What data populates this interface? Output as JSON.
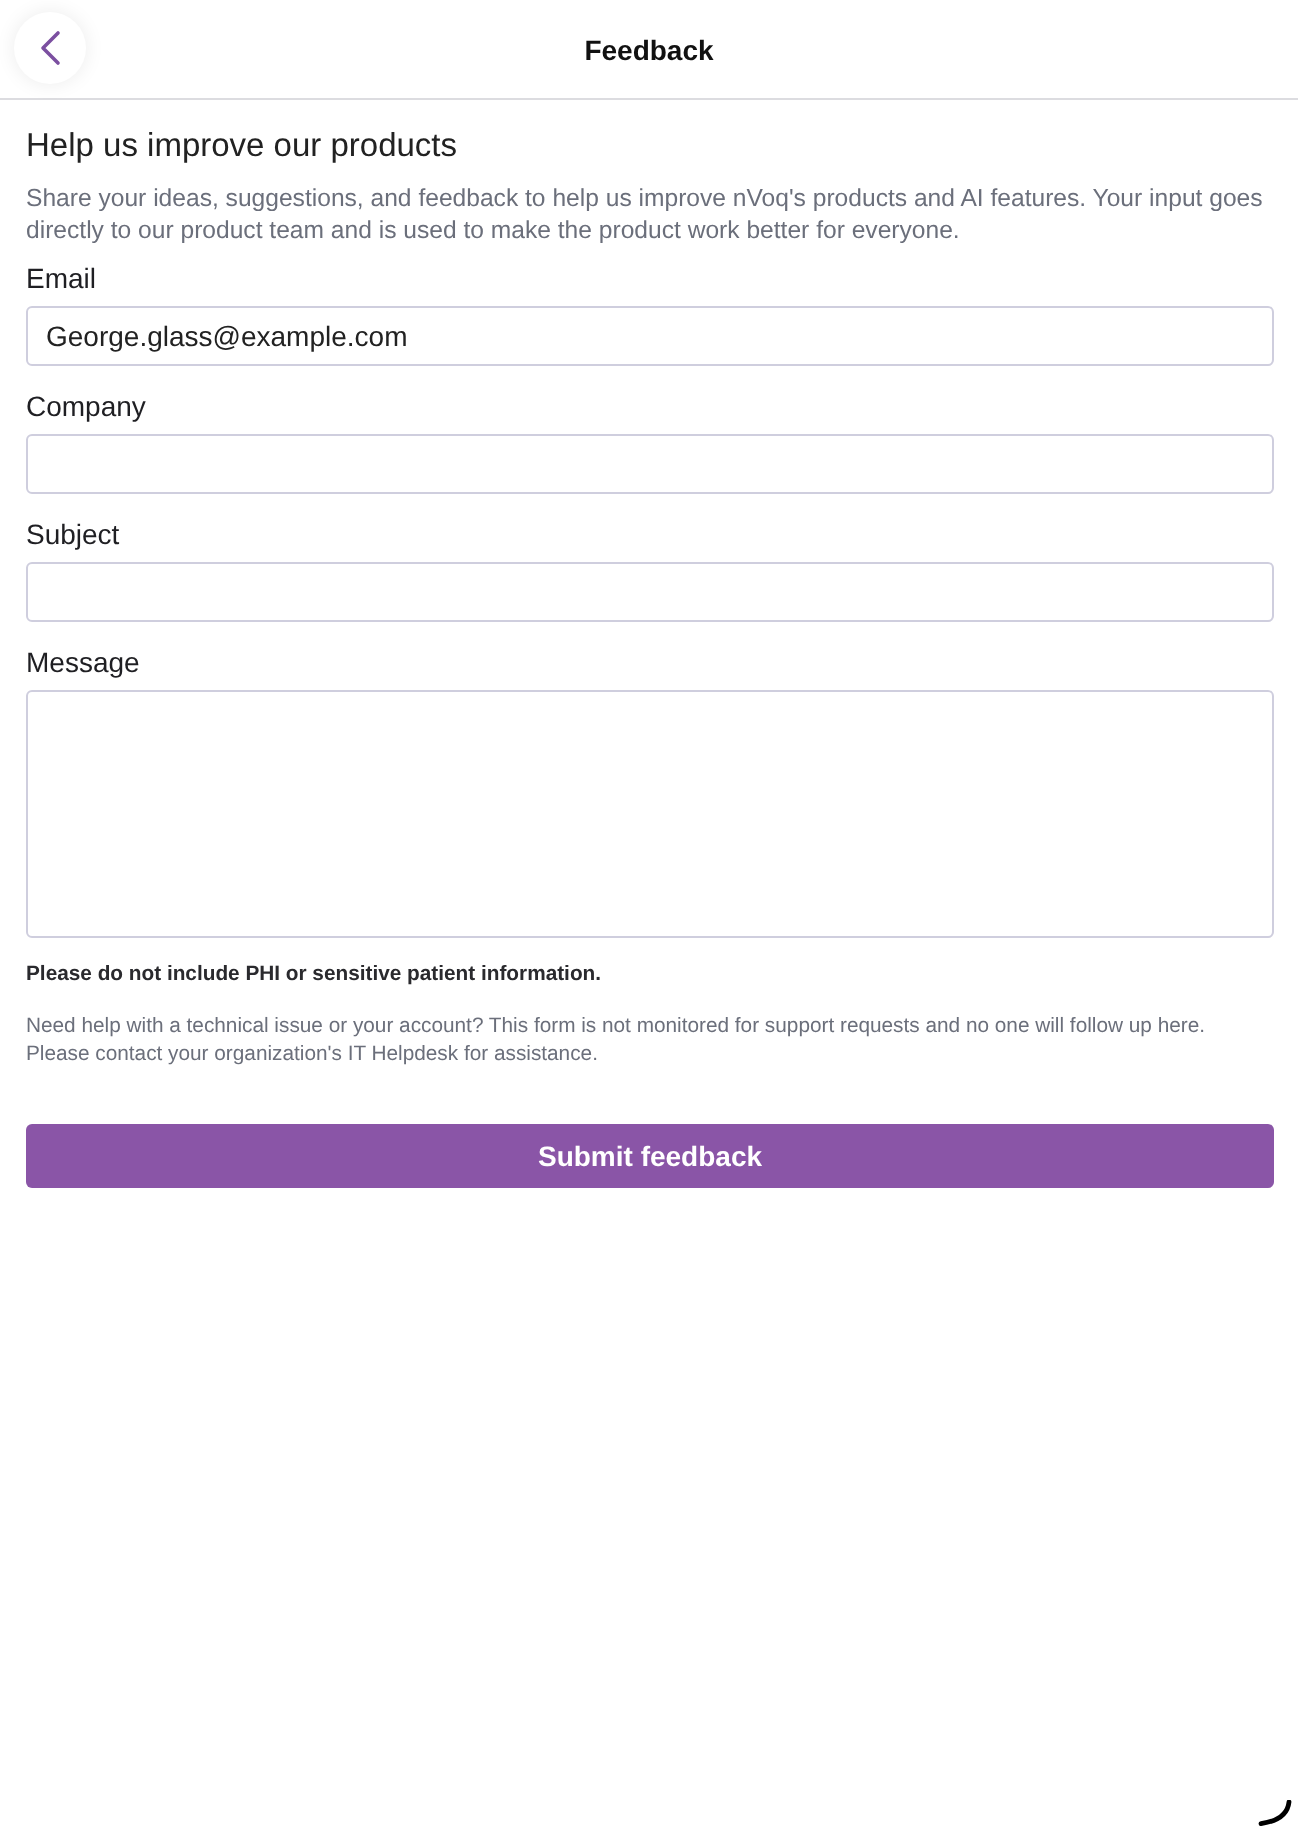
{
  "header": {
    "title": "Feedback"
  },
  "intro": {
    "heading": "Help us improve our products",
    "description": "Share your ideas, suggestions, and feedback to help us improve nVoq's products and AI features. Your input goes directly to our product team and is used to make the product work better for everyone."
  },
  "fields": [
    {
      "label": "Email",
      "kind": "input",
      "value": "George.glass@example.com"
    },
    {
      "label": "Company",
      "kind": "input"
    },
    {
      "label": "Subject",
      "kind": "input"
    },
    {
      "label": "Message",
      "kind": "textarea"
    }
  ],
  "notices": [
    {
      "kind": "warning",
      "text": "Please do not include PHI or sensitive patient information."
    },
    {
      "kind": "help",
      "text": "Need help with a technical issue or your account? This form is not monitored for support requests and no one will follow up here. Please contact your organization's IT Helpdesk for assistance."
    }
  ],
  "submit_button": {
    "label": "Submit feedback"
  }
}
